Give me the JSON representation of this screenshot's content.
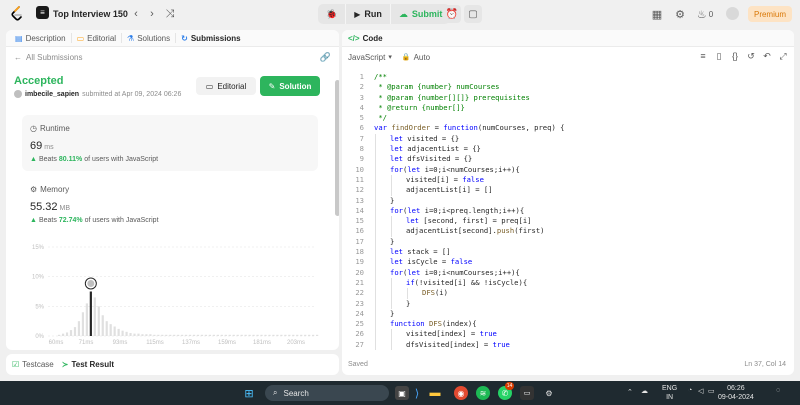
{
  "nav": {
    "problem_list_title": "Top Interview 150",
    "run_label": "Run",
    "submit_label": "Submit",
    "streak_count": "0",
    "premium_label": "Premium"
  },
  "left": {
    "tabs": [
      {
        "label": "Description",
        "icon": "description-icon"
      },
      {
        "label": "Editorial",
        "icon": "editorial-icon"
      },
      {
        "label": "Solutions",
        "icon": "solutions-icon"
      },
      {
        "label": "Submissions",
        "icon": "submissions-icon"
      }
    ],
    "all_submissions": "All Submissions",
    "status": "Accepted",
    "author": "imbecile_sapien",
    "submitted_text": "submitted at Apr 09, 2024 06:26",
    "editorial_button": "Editorial",
    "solution_button": "Solution",
    "runtime": {
      "label": "Runtime",
      "value": "69",
      "unit": "ms",
      "beats_prefix": "Beats",
      "beats_value": "80.11%",
      "beats_suffix": "of users with JavaScript"
    },
    "memory": {
      "label": "Memory",
      "value": "55.32",
      "unit": "MB",
      "beats_prefix": "Beats",
      "beats_value": "72.74%",
      "beats_suffix": "of users with JavaScript"
    },
    "bottom_tabs": [
      "Testcase",
      "Test Result"
    ]
  },
  "chart_data": {
    "type": "bar",
    "y_ticks": [
      "15%",
      "10%",
      "5%",
      "0%"
    ],
    "ylim": [
      0,
      15
    ],
    "x_ticks": [
      "60ms",
      "71ms",
      "93ms",
      "115ms",
      "137ms",
      "159ms",
      "181ms",
      "203ms"
    ],
    "values": [
      0.2,
      0.4,
      0.6,
      1.0,
      1.5,
      2.5,
      4.0,
      5.5,
      7.5,
      6.5,
      5.0,
      3.5,
      2.5,
      2.0,
      1.6,
      1.2,
      0.9,
      0.7,
      0.5,
      0.4,
      0.4,
      0.3,
      0.3,
      0.3,
      0.2,
      0.2,
      0.2,
      0.2,
      0.2,
      0.2,
      0.2,
      0.2,
      0.2,
      0.2,
      0.2,
      0.2,
      0.2,
      0.2,
      0.2,
      0.2,
      0.2,
      0.2,
      0.2,
      0.2,
      0.2,
      0.2,
      0.2,
      0.2,
      0.2,
      0.2,
      0.2,
      0.2,
      0.2,
      0.2,
      0.2,
      0.2,
      0.2,
      0.2,
      0.2,
      0.2,
      0.2,
      0.2,
      0.2,
      0.2,
      0.2,
      0.2
    ],
    "highlight_index": 8,
    "grid": true
  },
  "code_panel": {
    "title": "Code",
    "language": "JavaScript",
    "mode": "Auto",
    "status_left": "Saved",
    "status_right": "Ln 37, Col 14",
    "lines": [
      {
        "n": "1",
        "indent": 0,
        "html": "<span class=\"cm\">/**</span>"
      },
      {
        "n": "2",
        "indent": 0,
        "html": "<span class=\"cm\"> * @param {number} numCourses</span>"
      },
      {
        "n": "3",
        "indent": 0,
        "html": "<span class=\"cm\"> * @param {number[][]} prerequisites</span>"
      },
      {
        "n": "4",
        "indent": 0,
        "html": "<span class=\"cm\"> * @return {number[]}</span>"
      },
      {
        "n": "5",
        "indent": 0,
        "html": "<span class=\"cm\"> */</span>"
      },
      {
        "n": "6",
        "indent": 0,
        "html": "<span class=\"kw\">var</span> <span class=\"fn\">findOrder</span> = <span class=\"kw\">function</span>(numCourses, preq) {"
      },
      {
        "n": "7",
        "indent": 1,
        "html": "<span class=\"kw\">let</span> visited = {}"
      },
      {
        "n": "8",
        "indent": 1,
        "html": "<span class=\"kw\">let</span> adjacentList = {}"
      },
      {
        "n": "9",
        "indent": 1,
        "html": "<span class=\"kw\">let</span> dfsVisited = {}"
      },
      {
        "n": "10",
        "indent": 1,
        "html": "<span class=\"kw\">for</span>(<span class=\"kw\">let</span> i=0;i&lt;numCourses;i++){"
      },
      {
        "n": "11",
        "indent": 2,
        "html": "visited[i] = <span class=\"kw\">false</span>"
      },
      {
        "n": "12",
        "indent": 2,
        "html": "adjacentList[i] = []"
      },
      {
        "n": "13",
        "indent": 1,
        "html": "}"
      },
      {
        "n": "14",
        "indent": 1,
        "html": "<span class=\"kw\">for</span>(<span class=\"kw\">let</span> i=0;i&lt;preq.length;i++){"
      },
      {
        "n": "15",
        "indent": 2,
        "html": "<span class=\"kw\">let</span> [second, first] = preq[i]"
      },
      {
        "n": "16",
        "indent": 2,
        "html": "adjacentList[second].<span class=\"fn\">push</span>(first)"
      },
      {
        "n": "17",
        "indent": 1,
        "html": "}"
      },
      {
        "n": "18",
        "indent": 1,
        "html": "<span class=\"kw\">let</span> stack = []"
      },
      {
        "n": "19",
        "indent": 1,
        "html": "<span class=\"kw\">let</span> isCycle = <span class=\"kw\">false</span>"
      },
      {
        "n": "20",
        "indent": 1,
        "html": "<span class=\"kw\">for</span>(<span class=\"kw\">let</span> i=0;i&lt;numCourses;i++){"
      },
      {
        "n": "21",
        "indent": 2,
        "html": "<span class=\"kw\">if</span>(!visited[i] &amp;&amp; !isCycle){"
      },
      {
        "n": "22",
        "indent": 3,
        "html": "<span class=\"fn\">DFS</span>(i)"
      },
      {
        "n": "23",
        "indent": 2,
        "html": "}"
      },
      {
        "n": "24",
        "indent": 1,
        "html": "}"
      },
      {
        "n": "25",
        "indent": 1,
        "html": "<span class=\"kw\">function</span> <span class=\"fn\">DFS</span>(index){"
      },
      {
        "n": "26",
        "indent": 2,
        "html": "visited[index] = <span class=\"kw\">true</span>"
      },
      {
        "n": "27",
        "indent": 2,
        "html": "dfsVisited[index] = <span class=\"kw\">true</span>"
      }
    ]
  },
  "taskbar": {
    "search_placeholder": "Search",
    "lang_top": "ENG",
    "lang_bottom": "IN",
    "time": "06:26",
    "date": "09-04-2024",
    "badge": "14"
  }
}
